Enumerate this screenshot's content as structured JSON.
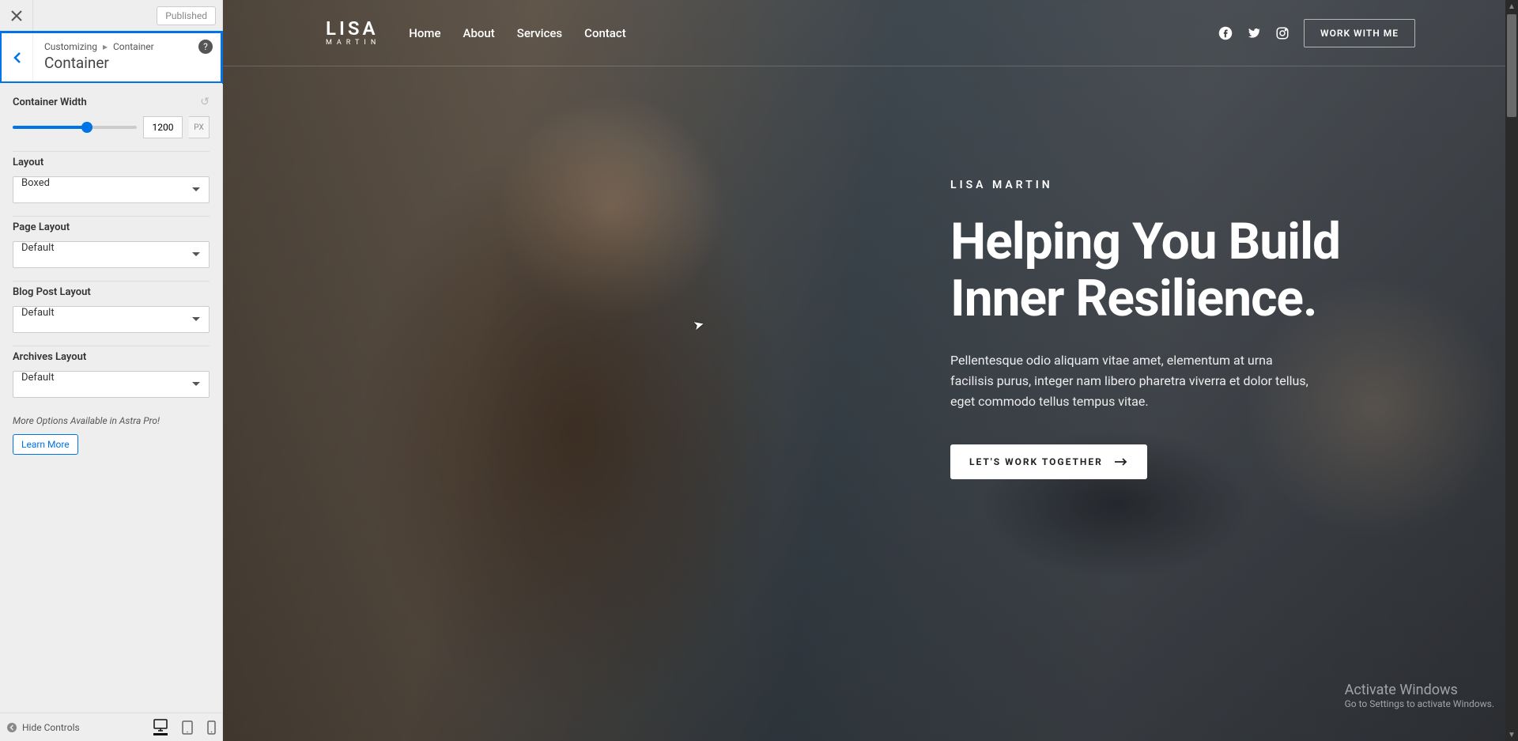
{
  "topbar": {
    "publish_status": "Published"
  },
  "header": {
    "breadcrumb_root": "Customizing",
    "breadcrumb_current": "Container",
    "title": "Container"
  },
  "controls": {
    "container_width": {
      "label": "Container Width",
      "value": "1200",
      "unit": "PX",
      "percent": 60
    },
    "layout": {
      "label": "Layout",
      "value": "Boxed"
    },
    "page_layout": {
      "label": "Page Layout",
      "value": "Default"
    },
    "blog_post_layout": {
      "label": "Blog Post Layout",
      "value": "Default"
    },
    "archives_layout": {
      "label": "Archives Layout",
      "value": "Default"
    }
  },
  "pro": {
    "note": "More Options Available in Astra Pro!",
    "learn_more": "Learn More"
  },
  "footer": {
    "hide_controls": "Hide Controls"
  },
  "site": {
    "logo_top": "LISA",
    "logo_bottom": "MARTIN",
    "nav": {
      "home": "Home",
      "about": "About",
      "services": "Services",
      "contact": "Contact"
    },
    "cta_header": "WORK WITH ME",
    "eyebrow": "LISA MARTIN",
    "hero_title": "Helping You Build Inner Resilience.",
    "hero_desc": "Pellentesque odio aliquam vitae amet, elementum at urna facilisis purus, integer nam libero pharetra viverra et dolor tellus, eget commodo tellus tempus vitae.",
    "hero_cta": "LET'S WORK TOGETHER"
  },
  "watermark": {
    "line1": "Activate Windows",
    "line2": "Go to Settings to activate Windows."
  }
}
